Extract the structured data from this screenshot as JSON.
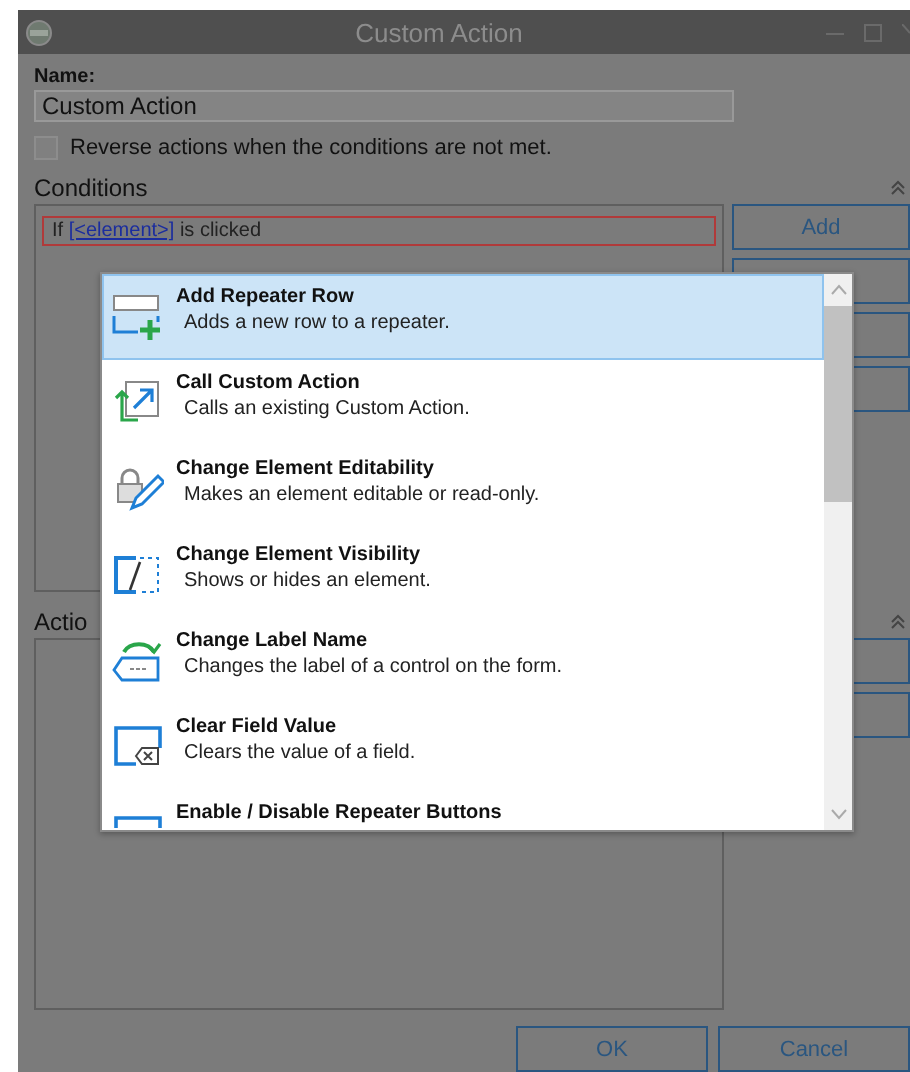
{
  "window": {
    "title": "Custom Action"
  },
  "name_field": {
    "label": "Name:",
    "value": "Custom Action"
  },
  "reverse_checkbox": {
    "label": "Reverse actions when the conditions are not met.",
    "checked": false
  },
  "conditions": {
    "title": "Conditions",
    "rows": [
      {
        "prefix": "If",
        "link": "[<element>]",
        "suffix": "is clicked",
        "invalid": true
      }
    ],
    "buttons": [
      {
        "label": "Add"
      },
      {
        "covered": true
      },
      {
        "covered": true
      },
      {
        "covered": true
      }
    ]
  },
  "actions": {
    "title": "Actio",
    "buttons": [
      {
        "covered": true
      },
      {
        "covered": true
      }
    ]
  },
  "popup": {
    "items": [
      {
        "kind": "add-row",
        "title": "Add Repeater Row",
        "description": "Adds a new row to a repeater.",
        "selected": true
      },
      {
        "kind": "call",
        "title": "Call Custom Action",
        "description": "Calls an existing Custom Action.",
        "selected": false
      },
      {
        "kind": "editability",
        "title": "Change Element Editability",
        "description": "Makes an element editable or read-only.",
        "selected": false
      },
      {
        "kind": "visibility",
        "title": "Change Element Visibility",
        "description": "Shows or hides an element.",
        "selected": false
      },
      {
        "kind": "label",
        "title": "Change Label Name",
        "description": "Changes the label of a control on the form.",
        "selected": false
      },
      {
        "kind": "clear",
        "title": "Clear Field Value",
        "description": "Clears the value of a field.",
        "selected": false
      },
      {
        "kind": "enable",
        "title": "Enable / Disable Repeater Buttons",
        "selected": false
      }
    ]
  },
  "footer": {
    "buttons": [
      "OK",
      "Cancel"
    ]
  }
}
